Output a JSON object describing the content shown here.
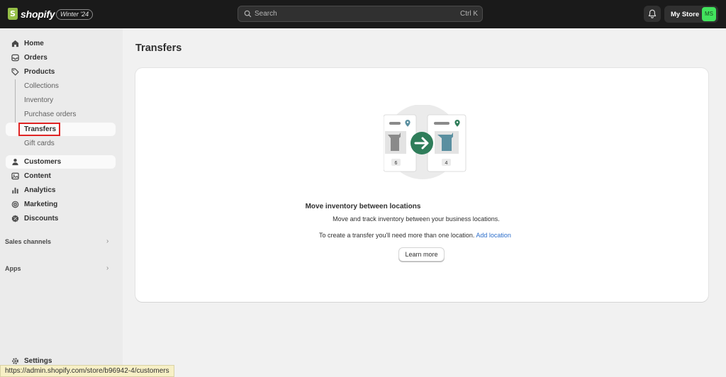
{
  "topbar": {
    "brand": "shopify",
    "edition_badge": "Winter '24",
    "search_placeholder": "Search",
    "search_shortcut": "Ctrl K",
    "store_name": "My Store",
    "store_initials": "MS"
  },
  "sidebar": {
    "items": [
      {
        "label": "Home",
        "icon": "home-icon"
      },
      {
        "label": "Orders",
        "icon": "inbox-icon"
      },
      {
        "label": "Products",
        "icon": "tag-icon"
      }
    ],
    "product_sub": [
      {
        "label": "Collections"
      },
      {
        "label": "Inventory"
      },
      {
        "label": "Purchase orders"
      },
      {
        "label": "Transfers"
      },
      {
        "label": "Gift cards"
      }
    ],
    "items2": [
      {
        "label": "Customers",
        "icon": "person-icon"
      },
      {
        "label": "Content",
        "icon": "content-icon"
      },
      {
        "label": "Analytics",
        "icon": "bar-chart-icon"
      },
      {
        "label": "Marketing",
        "icon": "target-icon"
      },
      {
        "label": "Discounts",
        "icon": "discount-icon"
      }
    ],
    "sales_channels": "Sales channels",
    "apps": "Apps",
    "settings": "Settings"
  },
  "main": {
    "title": "Transfers",
    "empty_title": "Move inventory between locations",
    "empty_desc": "Move and track inventory between your business locations.",
    "empty_hint": "To create a transfer you'll need more than one location.",
    "add_location": "Add location",
    "learn_more": "Learn more",
    "illus_count_left": "6",
    "illus_count_right": "4"
  },
  "status_url": "https://admin.shopify.com/store/b96942-4/customers",
  "colors": {
    "topbar": "#1a1a1a",
    "accent_green": "#2f7d5a",
    "link": "#2c6ecb",
    "highlight": "#e02424"
  }
}
